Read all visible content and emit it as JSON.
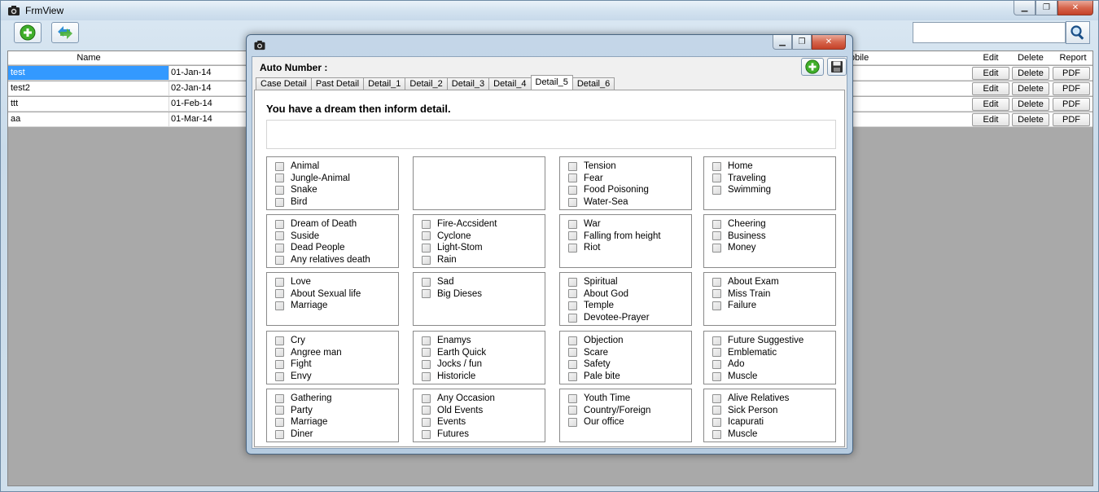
{
  "main": {
    "title": "FrmView",
    "columns": {
      "name": "Name",
      "mobile": "obile",
      "edit": "Edit",
      "delete": "Delete",
      "report": "Report"
    },
    "rows": [
      {
        "name": "test",
        "date": "01-Jan-14",
        "edit": "Edit",
        "delete": "Delete",
        "pdf": "PDF"
      },
      {
        "name": "test2",
        "date": "02-Jan-14",
        "edit": "Edit",
        "delete": "Delete",
        "pdf": "PDF"
      },
      {
        "name": "ttt",
        "date": "01-Feb-14",
        "edit": "Edit",
        "delete": "Delete",
        "pdf": "PDF"
      },
      {
        "name": "aa",
        "date": "01-Mar-14",
        "edit": "Edit",
        "delete": "Delete",
        "pdf": "PDF"
      }
    ],
    "search_value": ""
  },
  "dialog": {
    "auto_number_label": "Auto Number :",
    "tabs": [
      "Case Detail",
      "Past Detail",
      "Detail_1",
      "Detail_2",
      "Detail_3",
      "Detail_4",
      "Detail_5",
      "Detail_6"
    ],
    "active_tab": "Detail_5",
    "question": "You have a dream then inform detail.",
    "answer_value": "",
    "groups": [
      [
        "Animal",
        "Jungle-Animal",
        "Snake",
        "Bird"
      ],
      [],
      [
        "Tension",
        "Fear",
        "Food Poisoning",
        "Water-Sea"
      ],
      [
        "Home",
        "Traveling",
        "Swimming"
      ],
      [
        "Dream of Death",
        "Suside",
        "Dead People",
        "Any relatives death"
      ],
      [
        "Fire-Accsident",
        "Cyclone",
        "Light-Stom",
        "Rain"
      ],
      [
        "War",
        "Falling from height",
        "Riot"
      ],
      [
        "Cheering",
        "Business",
        "Money"
      ],
      [
        "Love",
        "About Sexual life",
        "Marriage"
      ],
      [
        "Sad",
        "Big Dieses"
      ],
      [
        "Spiritual",
        "About God",
        "Temple",
        "Devotee-Prayer"
      ],
      [
        "About Exam",
        "Miss Train",
        "Failure"
      ],
      [
        "Cry",
        "Angree man",
        "Fight",
        "Envy"
      ],
      [
        "Enamys",
        "Earth Quick",
        "Jocks / fun",
        "Historicle"
      ],
      [
        "Objection",
        "Scare",
        "Safety",
        "Pale bite"
      ],
      [
        "Future Suggestive",
        "Emblematic",
        "Ado",
        "Muscle"
      ],
      [
        "Gathering",
        "Party",
        "Marriage",
        "Diner"
      ],
      [
        "Any Occasion",
        "Old Events",
        "Events",
        "Futures"
      ],
      [
        "Youth Time",
        "Country/Foreign",
        "Our office"
      ],
      [
        "Alive Relatives",
        "Sick Person",
        "Icapurati",
        "Muscle"
      ]
    ]
  },
  "colors": {
    "selection": "#3399ff",
    "grid_bg": "#a9a9a9"
  }
}
